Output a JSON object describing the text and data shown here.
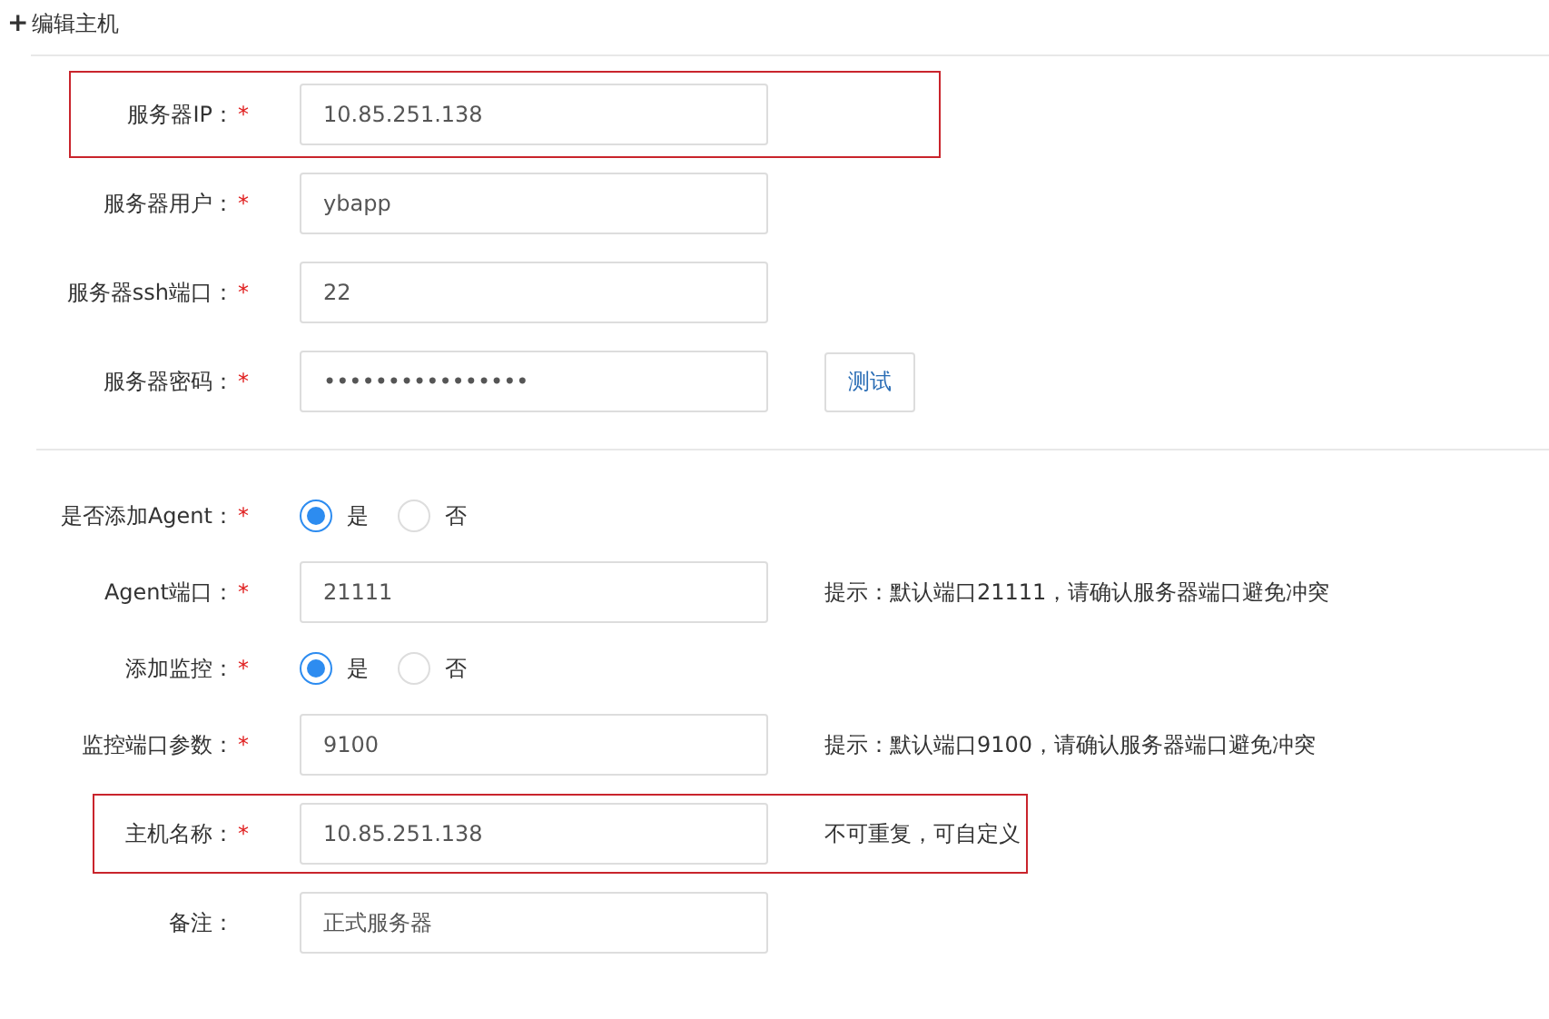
{
  "header": {
    "icon": "+",
    "title": "编辑主机"
  },
  "sections": [
    {
      "fields": [
        {
          "kind": "text",
          "label": "服务器IP：",
          "required": "*",
          "value": "10.85.251.138",
          "highlighted": true
        },
        {
          "kind": "text",
          "label": "服务器用户：",
          "required": "*",
          "value": "ybapp",
          "highlighted": false
        },
        {
          "kind": "text",
          "label": "服务器ssh端口：",
          "required": "*",
          "value": "22",
          "highlighted": false
        },
        {
          "kind": "text",
          "label": "服务器密码：",
          "required": "*",
          "value": "••••••••••••••••",
          "highlighted": false,
          "button": "测试"
        }
      ]
    },
    {
      "fields": [
        {
          "kind": "radio",
          "label": "是否添加Agent：",
          "required": "*",
          "options": [
            {
              "label": "是",
              "selected": true
            },
            {
              "label": "否",
              "selected": false
            }
          ]
        },
        {
          "kind": "text",
          "label": "Agent端口：",
          "required": "*",
          "value": "21111",
          "highlighted": false,
          "hint": "提示：默认端口21111，请确认服务器端口避免冲突"
        },
        {
          "kind": "radio",
          "label": "添加监控：",
          "required": "*",
          "options": [
            {
              "label": "是",
              "selected": true
            },
            {
              "label": "否",
              "selected": false
            }
          ]
        },
        {
          "kind": "text",
          "label": "监控端口参数：",
          "required": "*",
          "value": "9100",
          "highlighted": false,
          "hint": "提示：默认端口9100，请确认服务器端口避免冲突"
        },
        {
          "kind": "text",
          "label": "主机名称：",
          "required": "*",
          "value": "10.85.251.138",
          "highlighted": true,
          "hint": "不可重复，可自定义"
        },
        {
          "kind": "text",
          "label": "备注：",
          "value": "正式服务器",
          "highlighted": false
        }
      ]
    }
  ]
}
